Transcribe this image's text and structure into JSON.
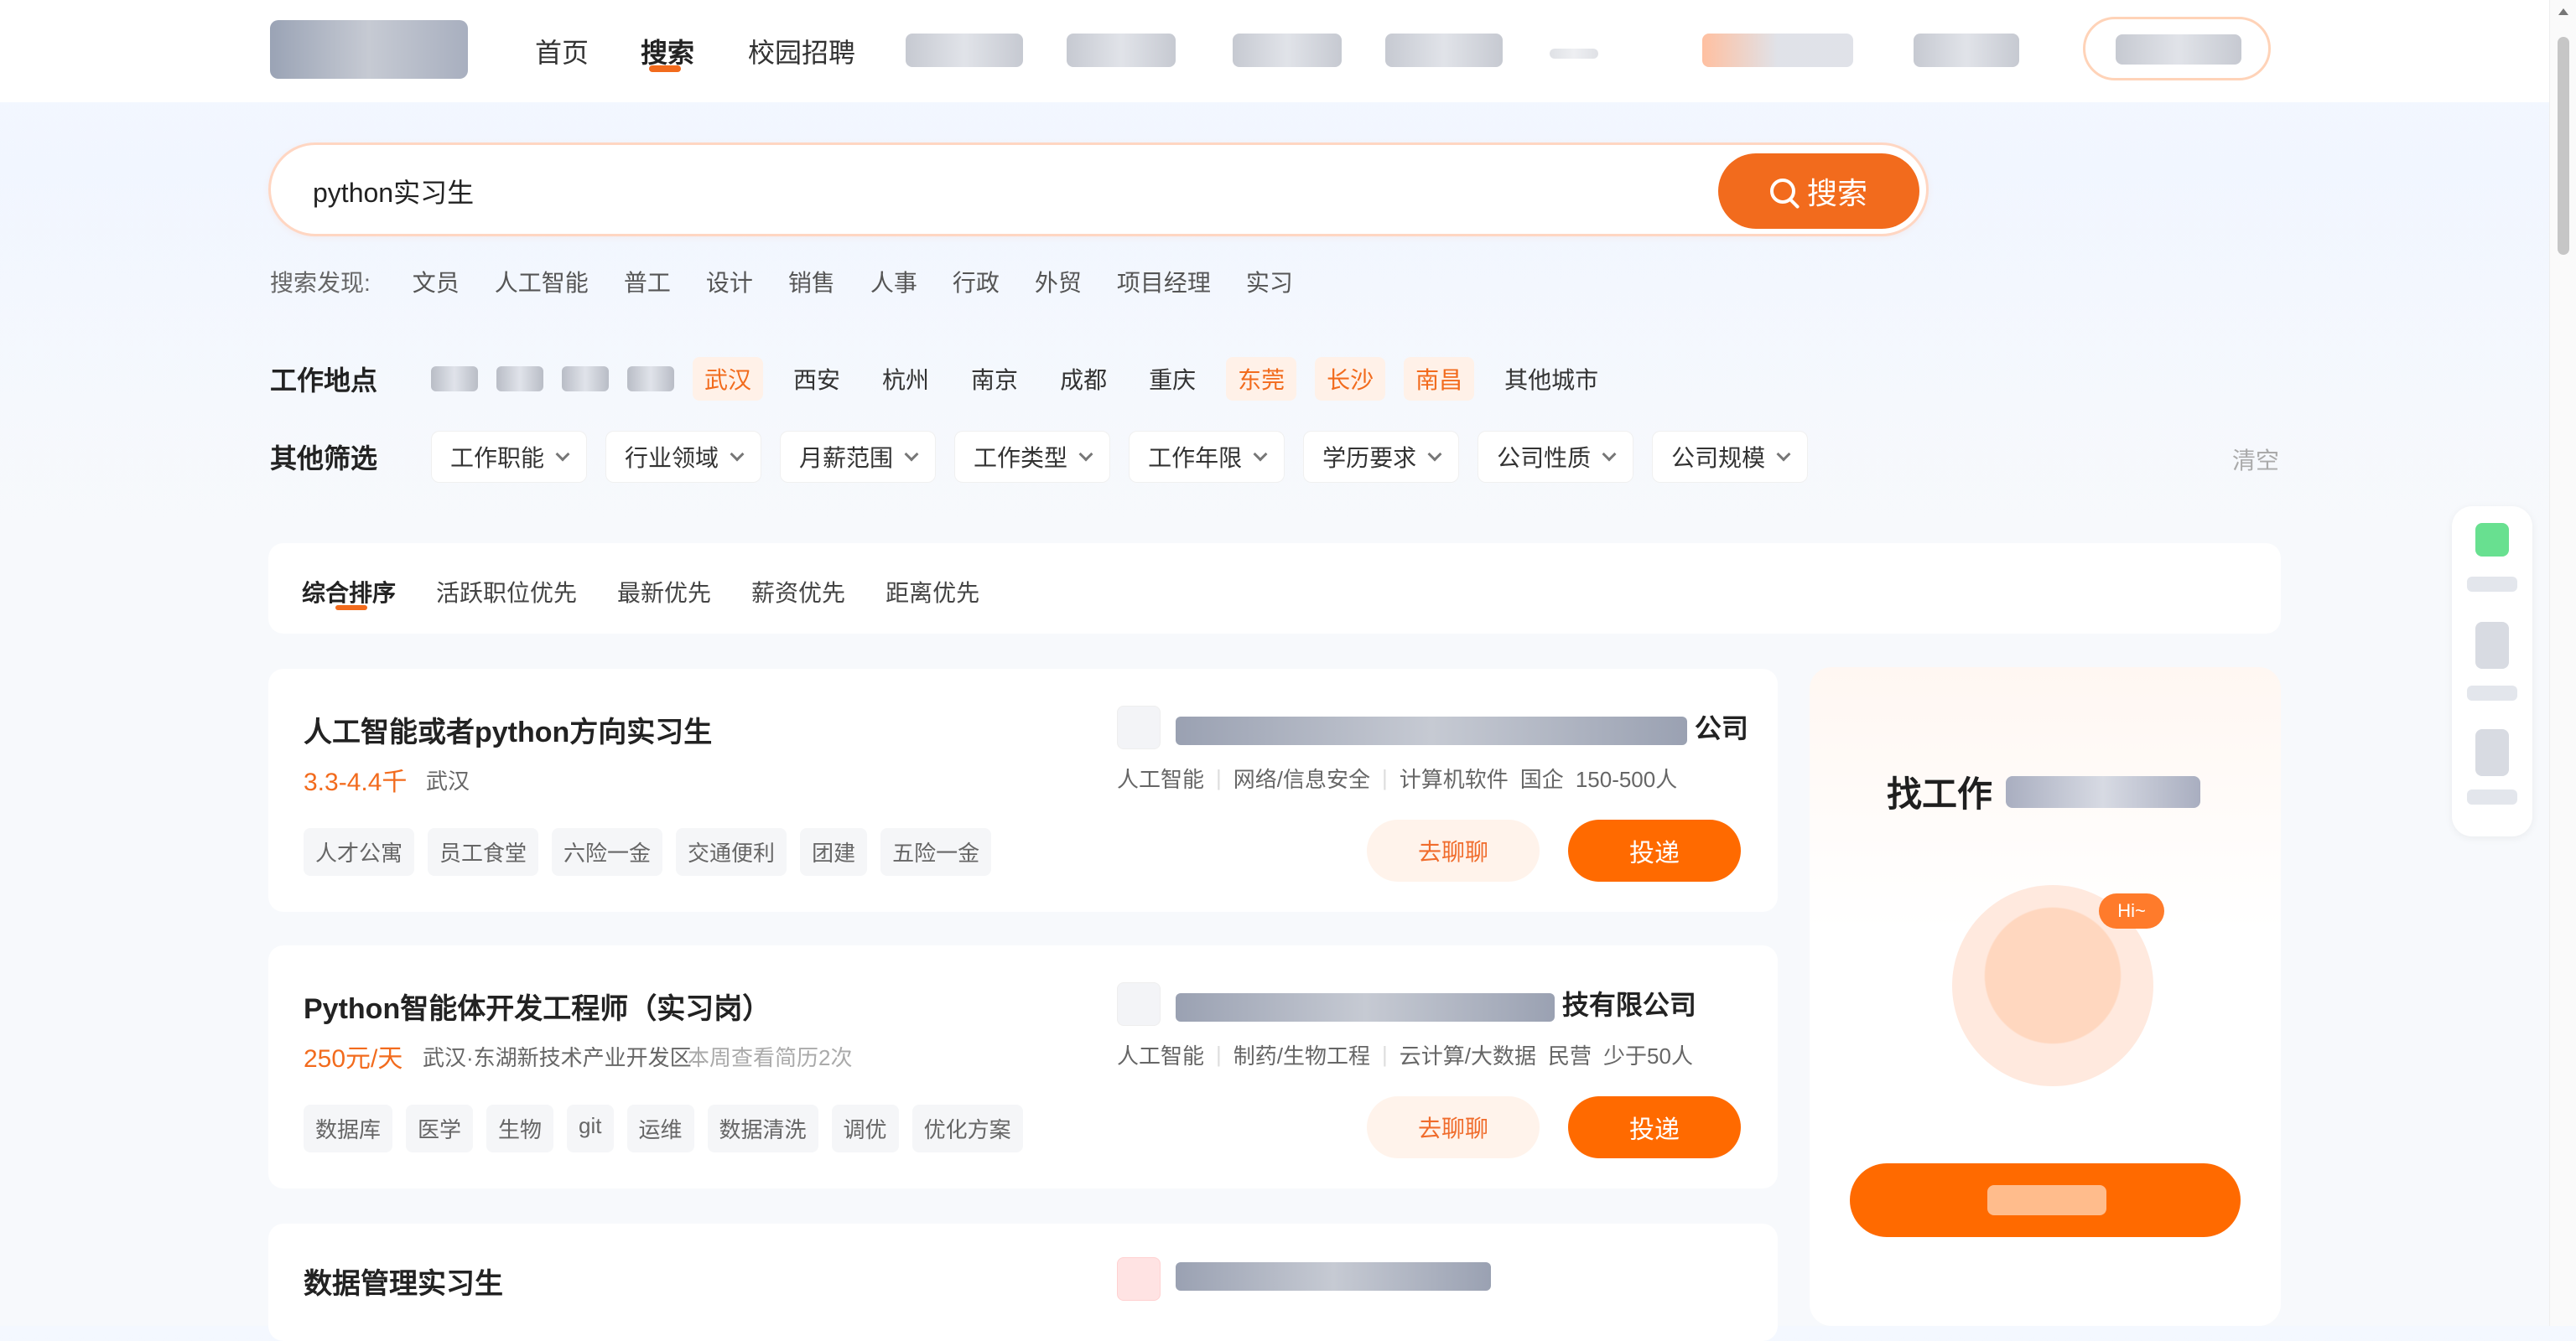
{
  "nav": {
    "items": [
      "首页",
      "搜索",
      "校园招聘"
    ],
    "active": "搜索"
  },
  "search": {
    "query": "python实习生",
    "button_label": "搜索"
  },
  "discover": {
    "label": "搜索发现:",
    "chips": [
      "文员",
      "人工智能",
      "普工",
      "设计",
      "销售",
      "人事",
      "行政",
      "外贸",
      "项目经理",
      "实习"
    ]
  },
  "location": {
    "title": "工作地点",
    "cities": [
      "武汉",
      "西安",
      "杭州",
      "南京",
      "成都",
      "重庆",
      "东莞",
      "长沙",
      "南昌",
      "其他城市"
    ],
    "highlighted": [
      "武汉",
      "东莞",
      "长沙",
      "南昌"
    ]
  },
  "filters": {
    "title": "其他筛选",
    "items": [
      "工作职能",
      "行业领域",
      "月薪范围",
      "工作类型",
      "工作年限",
      "学历要求",
      "公司性质",
      "公司规模"
    ],
    "clear_label": "清空"
  },
  "sort": {
    "items": [
      "综合排序",
      "活跃职位优先",
      "最新优先",
      "薪资优先",
      "距离优先"
    ],
    "active": "综合排序"
  },
  "jobs": [
    {
      "title": "人工智能或者python方向实习生",
      "salary": "3.3-4.4千",
      "location": "武汉",
      "extra": "",
      "tags": [
        "人才公寓",
        "员工食堂",
        "六险一金",
        "交通便利",
        "团建",
        "五险一金"
      ],
      "company": {
        "name_suffix": "公司",
        "meta": [
          "人工智能",
          "网络/信息安全",
          "计算机软件",
          "国企",
          "150-500人"
        ]
      },
      "chat_label": "去聊聊",
      "apply_label": "投递"
    },
    {
      "title": "Python智能体开发工程师（实习岗）",
      "salary": "250元/天",
      "location": "武汉·东湖新技术产业开发区",
      "extra": "本周查看简历2次",
      "tags": [
        "数据库",
        "医学",
        "生物",
        "git",
        "运维",
        "数据清洗",
        "调优",
        "优化方案"
      ],
      "company": {
        "name_suffix": "技有限公司",
        "meta": [
          "人工智能",
          "制药/生物工程",
          "云计算/大数据",
          "民营",
          "少于50人"
        ]
      },
      "chat_label": "去聊聊",
      "apply_label": "投递"
    },
    {
      "title": "数据管理实习生"
    }
  ],
  "promo": {
    "title_prefix": "找工作",
    "badge": "Hi~"
  }
}
